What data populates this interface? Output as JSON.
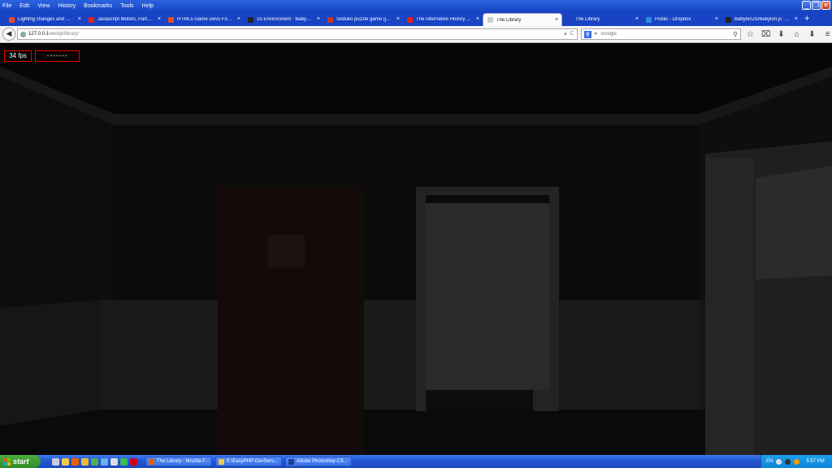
{
  "window": {
    "menu": [
      "File",
      "Edit",
      "View",
      "History",
      "Bookmarks",
      "Tools",
      "Help"
    ],
    "controls": {
      "minimize": "_",
      "restore": "❐",
      "close": "✕"
    }
  },
  "tabs": [
    {
      "label": "Lighting changes and Ble...",
      "icon": "html5-icon",
      "color": "#e44d26",
      "active": false
    },
    {
      "label": "Javascript Motion, Partic...",
      "icon": "youtube-icon",
      "color": "#e62117",
      "active": false
    },
    {
      "label": "HTML5 Game Devs Forum",
      "icon": "html5-icon",
      "color": "#e44d26",
      "active": false
    },
    {
      "label": "15 Environment · Babylo...",
      "icon": "github-icon",
      "color": "#222222",
      "active": false
    },
    {
      "label": "Soduko puzzle game (ja...",
      "icon": "puzzle-icon",
      "color": "#c0392b",
      "active": false
    },
    {
      "label": "The Alternative History ...",
      "icon": "youtube-icon",
      "color": "#e62117",
      "active": false
    },
    {
      "label": "The Library",
      "icon": "page-icon",
      "color": "#cccccc",
      "active": true
    },
    {
      "label": "The Library",
      "icon": "page-icon",
      "color": "#1743c4",
      "active": false
    },
    {
      "label": "Public - Dropbox",
      "icon": "dropbox-icon",
      "color": "#2c8be0",
      "active": false
    },
    {
      "label": "BabylonJS/Babylon.js · ...",
      "icon": "github-icon",
      "color": "#222222",
      "active": false
    }
  ],
  "tab_close": "×",
  "new_tab": "+",
  "nav": {
    "back": "◀",
    "url_host": "127.0.0.1",
    "url_path": "/webgl/library/",
    "url_icons": [
      "▾",
      "C"
    ],
    "search_engine": "g",
    "search_placeholder": "Google",
    "search_go": "⚲",
    "toolbar": [
      "☆",
      "⌧",
      "⬇",
      "⌂",
      "⬇",
      "≡"
    ]
  },
  "overlay": {
    "fps": "34 fps",
    "status": "-------"
  },
  "taskbar": {
    "start": "start",
    "tasks": [
      {
        "label": "The Library - Mozilla F...",
        "color": "#e66000"
      },
      {
        "label": "E:\\EasyPHP-DevServ...",
        "color": "#f2c94c"
      },
      {
        "label": "Adobe Photoshop CS...",
        "color": "#1c3f8f"
      }
    ],
    "tray": {
      "lang": "EN",
      "clock": "5:57 PM"
    }
  }
}
